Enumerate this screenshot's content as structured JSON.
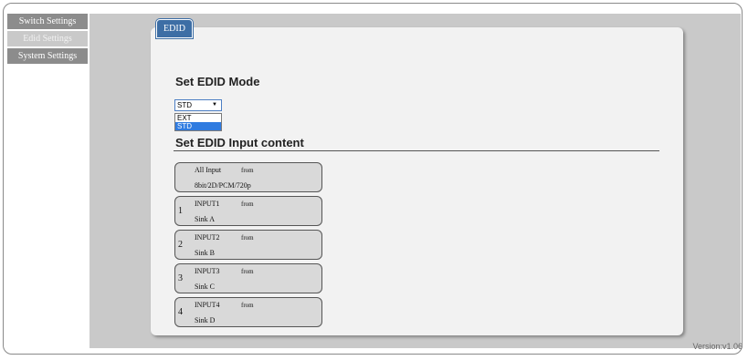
{
  "sidebar": {
    "items": [
      {
        "label": "Switch Settings",
        "selected": false
      },
      {
        "label": "Edid Settings",
        "selected": true
      },
      {
        "label": "System Settings",
        "selected": false
      }
    ]
  },
  "tab": {
    "label": "EDID"
  },
  "mode_section": {
    "title": "Set EDID Mode",
    "select_value": "STD",
    "options": [
      "EXT",
      "STD"
    ],
    "highlighted_option": "STD"
  },
  "content_section": {
    "title": "Set EDID Input content",
    "inputs": [
      {
        "number": "",
        "name": "All Input",
        "from": "from",
        "source": "8bit/2D/PCM/720p"
      },
      {
        "number": "1",
        "name": "INPUT1",
        "from": "from",
        "source": "Sink A"
      },
      {
        "number": "2",
        "name": "INPUT2",
        "from": "from",
        "source": "Sink B"
      },
      {
        "number": "3",
        "name": "INPUT3",
        "from": "from",
        "source": "Sink C"
      },
      {
        "number": "4",
        "name": "INPUT4",
        "from": "from",
        "source": "Sink D"
      }
    ]
  },
  "footer": {
    "version": "Version:v1.06"
  },
  "colors": {
    "tab": "#3d6ea5",
    "sidebar": "#8c8c8c",
    "highlight": "#2f7be0"
  }
}
